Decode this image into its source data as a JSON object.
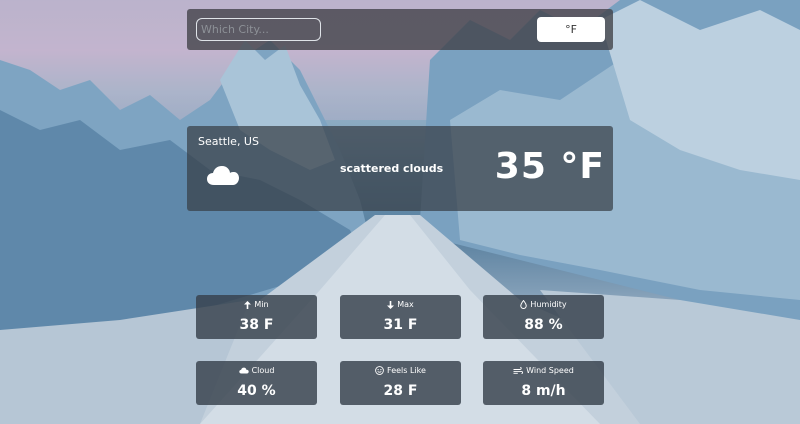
{
  "search": {
    "placeholder": "Which City...",
    "value": ""
  },
  "unit_toggle": {
    "label": "°F"
  },
  "current": {
    "location": "Seattle, US",
    "condition": "scattered clouds",
    "temperature": "35 °F",
    "icon": "cloud-icon"
  },
  "stats": {
    "min": {
      "label": "Min",
      "value": "38 F",
      "icon": "arrow-up-icon"
    },
    "max": {
      "label": "Max",
      "value": "31 F",
      "icon": "arrow-down-icon"
    },
    "humidity": {
      "label": "Humidity",
      "value": "88 %",
      "icon": "droplet-icon"
    },
    "cloud": {
      "label": "Cloud",
      "value": "40 %",
      "icon": "cloud-icon"
    },
    "feels_like": {
      "label": "Feels Like",
      "value": "28 F",
      "icon": "smiley-icon"
    },
    "wind_speed": {
      "label": "Wind Speed",
      "value": "8 m/h",
      "icon": "wind-icon"
    }
  }
}
